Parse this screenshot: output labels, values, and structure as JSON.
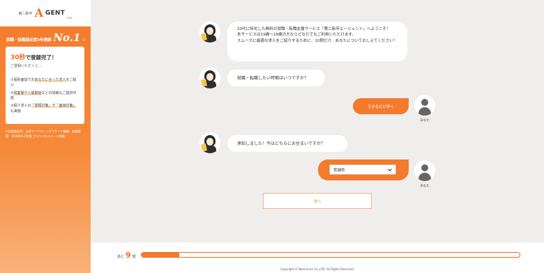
{
  "sidebar": {
    "logo": {
      "small": "第二新卒",
      "a": "A",
      "gent": "GENT",
      "neo": "neo"
    },
    "rank": {
      "text": "就職・転職満足度3年連続",
      "no1": "No.1",
      "mark": "※"
    },
    "card": {
      "title_em": "30秒",
      "title_rest": "で登録完了！",
      "subtitle": "ご登録いただくと…",
      "items": [
        {
          "num": "①",
          "pre": "個別面談でお",
          "hl": "あなたに合った求人",
          "post": "をご紹介"
        },
        {
          "num": "②",
          "pre": "",
          "hl": "残業量や人間関係",
          "post": "などの情報もご提供可能"
        },
        {
          "num": "③",
          "pre": "紹介求人の",
          "hl": "「書類対策」や「面接対策」",
          "post": "も実施"
        }
      ]
    },
    "note": "※実施委託先：日本マーケティングリサーチ機構　調査概要：2020年12月期_ブランドのイメージ調査"
  },
  "chat": {
    "messages": [
      {
        "text": "20代に特化した無料の就職・転職支援サービス「第二新卒エージェント」へようこそ！\n本サービスは19歳〜29歳の方ならどなたでもご利用いただけます。\nスムーズに最適な求人をご紹介するために、10問だけ、あなたについておしえてください！"
      },
      {
        "text": "就職・転職したい時期はいつですか？"
      },
      {
        "text": "承知しました！今はどちらにお住まいですか？"
      }
    ],
    "user_answer": "できるだけ早く",
    "user_label": "あなた",
    "prefecture_selected": "宮城県",
    "next_label": "次へ"
  },
  "footer": {
    "remain_prefix": "あと",
    "remain_count": "9",
    "remain_suffix": "問",
    "progress_fraction": 0.1,
    "copyright": "Copyright © NeoCareer Co.,LTD. All Rights Reserved."
  },
  "colors": {
    "accent": "#f47a2c",
    "background": "#efeeec"
  }
}
